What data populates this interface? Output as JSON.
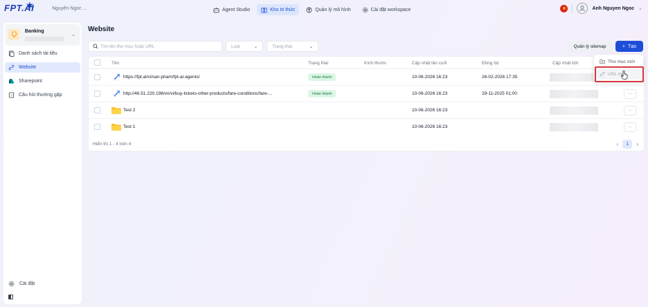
{
  "header": {
    "logo_text": "FPT.AI",
    "org_name": "Nguyên Ngoc ...",
    "nav": [
      {
        "label": "Agent Studio",
        "icon": "bot-icon"
      },
      {
        "label": "Kho tri thức",
        "icon": "book-icon"
      },
      {
        "label": "Quản lý mô hình",
        "icon": "model-icon"
      },
      {
        "label": "Cài đặt workspace",
        "icon": "gear-icon"
      }
    ],
    "user_name": "Anh Nguyen Ngoc",
    "flag_symbol": "★"
  },
  "sidebar": {
    "kb_name": "Banking",
    "items": [
      {
        "label": "Danh sách tài liệu",
        "icon": "document-icon"
      },
      {
        "label": "Website",
        "icon": "link-icon"
      },
      {
        "label": "Sharepoint",
        "icon": "sharepoint-icon"
      },
      {
        "label": "Câu hỏi thường gặp",
        "icon": "faq-icon"
      }
    ],
    "settings_label": "Cài đặt"
  },
  "main": {
    "title": "Website",
    "search_placeholder": "Tìm tên thư mục hoặc URL",
    "filter_type": "Loại",
    "filter_status": "Trạng thái",
    "sitemap_button": "Quản lý sitemap",
    "create_button": "Tạo",
    "columns": [
      "Tên",
      "Trạng thái",
      "Kích thước",
      "Cập nhật lần cuối",
      "Đồng bộ",
      "Cập nhật bởi"
    ],
    "rows": [
      {
        "kind": "url",
        "name": "https://fpt.ai/vi/san-pham/fpt-ai-agents/",
        "status": "Hoàn thành",
        "updated": "10-06-2026 16:23",
        "synced": "26-02-2026 17:35"
      },
      {
        "kind": "url",
        "name": "http://46.51.220.198/vn/vi/buy-tickets-other-products/fare-conditions/fare-...",
        "status": "Hoàn thành",
        "updated": "10-06-2026 16:23",
        "synced": "29-11-2025 01:00"
      },
      {
        "kind": "folder",
        "name": "Test 2",
        "status": "",
        "updated": "10-06-2026 16:23",
        "synced": ""
      },
      {
        "kind": "folder",
        "name": "Test 1",
        "status": "",
        "updated": "10-06-2026 16:23",
        "synced": ""
      }
    ],
    "more_label": "···",
    "footer_text": "Hiển thị 1 - 4 trên 4",
    "current_page": "1"
  },
  "dropdown": {
    "items": [
      {
        "label": "Thư mục mới",
        "icon": "folder-plus-icon"
      },
      {
        "label": "URL mới",
        "icon": "link-icon"
      }
    ]
  },
  "colors": {
    "accent": "#1d4ed8",
    "success_bg": "#dcf5e6",
    "success_text": "#15803d",
    "highlight_border": "#d9363e",
    "folder": "#fbbf24"
  }
}
